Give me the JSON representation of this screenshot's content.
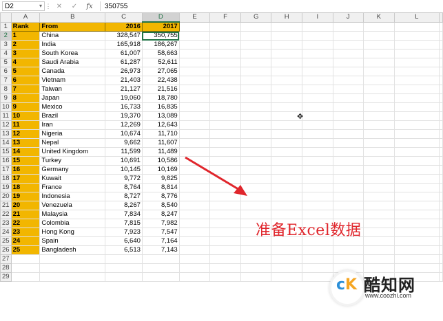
{
  "formula_bar": {
    "name_box": "D2",
    "value": "350755",
    "icons": [
      "cancel-icon",
      "confirm-icon",
      "function-icon"
    ]
  },
  "columns": [
    "A",
    "B",
    "C",
    "D",
    "E",
    "F",
    "G",
    "H",
    "I",
    "J",
    "K",
    "L"
  ],
  "selected_cell": "D2",
  "table": {
    "headers": [
      "Rank",
      "From",
      "2016",
      "2017"
    ],
    "rows": [
      [
        "1",
        "China",
        "328,547",
        "350,755"
      ],
      [
        "2",
        "India",
        "165,918",
        "186,267"
      ],
      [
        "3",
        "South Korea",
        "61,007",
        "58,663"
      ],
      [
        "4",
        "Saudi Arabia",
        "61,287",
        "52,611"
      ],
      [
        "5",
        "Canada",
        "26,973",
        "27,065"
      ],
      [
        "6",
        "Vietnam",
        "21,403",
        "22,438"
      ],
      [
        "7",
        "Taiwan",
        "21,127",
        "21,516"
      ],
      [
        "8",
        "Japan",
        "19,060",
        "18,780"
      ],
      [
        "9",
        "Mexico",
        "16,733",
        "16,835"
      ],
      [
        "10",
        "Brazil",
        "19,370",
        "13,089"
      ],
      [
        "11",
        "Iran",
        "12,269",
        "12,643"
      ],
      [
        "12",
        "Nigeria",
        "10,674",
        "11,710"
      ],
      [
        "13",
        "Nepal",
        "9,662",
        "11,607"
      ],
      [
        "14",
        "United Kingdom",
        "11,599",
        "11,489"
      ],
      [
        "15",
        "Turkey",
        "10,691",
        "10,586"
      ],
      [
        "16",
        "Germany",
        "10,145",
        "10,169"
      ],
      [
        "17",
        "Kuwait",
        "9,772",
        "9,825"
      ],
      [
        "18",
        "France",
        "8,764",
        "8,814"
      ],
      [
        "19",
        "Indonesia",
        "8,727",
        "8,776"
      ],
      [
        "20",
        "Venezuela",
        "8,267",
        "8,540"
      ],
      [
        "21",
        "Malaysia",
        "7,834",
        "8,247"
      ],
      [
        "22",
        "Colombia",
        "7,815",
        "7,982"
      ],
      [
        "23",
        "Hong Kong",
        "7,923",
        "7,547"
      ],
      [
        "24",
        "Spain",
        "6,640",
        "7,164"
      ],
      [
        "25",
        "Bangladesh",
        "6,513",
        "7,143"
      ]
    ]
  },
  "total_rows_shown": 29,
  "annotation": {
    "text": "准备Excel数据",
    "color": "#e0262c"
  },
  "watermark": {
    "name": "酷知网",
    "url": "www.coozhi.com"
  },
  "colors": {
    "header_fill": "#f2b600",
    "selection": "#217346"
  }
}
